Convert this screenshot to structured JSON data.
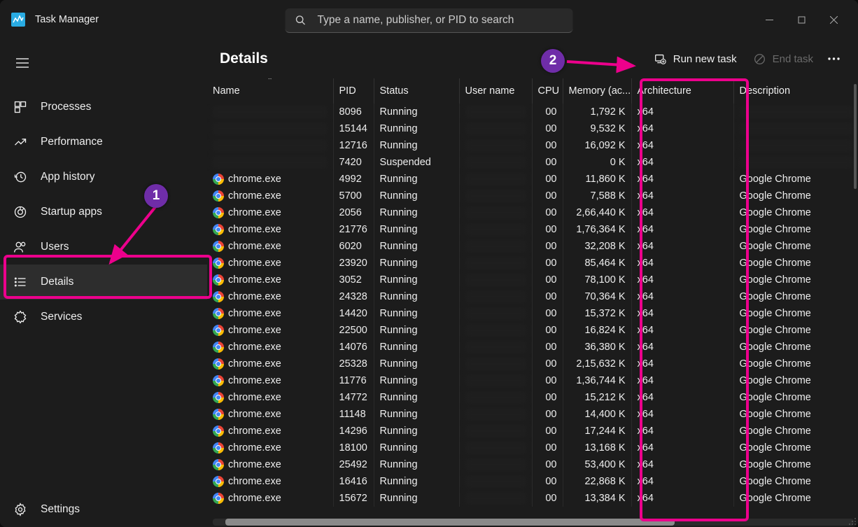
{
  "app": {
    "title": "Task Manager",
    "search_placeholder": "Type a name, publisher, or PID to search"
  },
  "sidebar": {
    "items": [
      {
        "label": "Processes"
      },
      {
        "label": "Performance"
      },
      {
        "label": "App history"
      },
      {
        "label": "Startup apps"
      },
      {
        "label": "Users"
      },
      {
        "label": "Details"
      },
      {
        "label": "Services"
      }
    ],
    "settings_label": "Settings"
  },
  "header": {
    "title": "Details",
    "run_new": "Run new task",
    "end_task": "End task"
  },
  "columns": {
    "name": "Name",
    "pid": "PID",
    "status": "Status",
    "user": "User name",
    "cpu": "CPU",
    "mem": "Memory (ac...",
    "arch": "Architecture",
    "desc": "Description"
  },
  "annotations": {
    "badge1": "1",
    "badge2": "2"
  },
  "rows": [
    {
      "name": "",
      "pid": "8096",
      "status": "Running",
      "cpu": "00",
      "mem": "1,792 K",
      "arch": "x64",
      "desc": "",
      "redact": true
    },
    {
      "name": "",
      "pid": "15144",
      "status": "Running",
      "cpu": "00",
      "mem": "9,532 K",
      "arch": "x64",
      "desc": "",
      "redact": true
    },
    {
      "name": "",
      "pid": "12716",
      "status": "Running",
      "cpu": "00",
      "mem": "16,092 K",
      "arch": "x64",
      "desc": "",
      "redact": true
    },
    {
      "name": "",
      "pid": "7420",
      "status": "Suspended",
      "cpu": "00",
      "mem": "0 K",
      "arch": "x64",
      "desc": "",
      "redact": true
    },
    {
      "name": "chrome.exe",
      "pid": "4992",
      "status": "Running",
      "cpu": "00",
      "mem": "11,860 K",
      "arch": "x64",
      "desc": "Google Chrome"
    },
    {
      "name": "chrome.exe",
      "pid": "5700",
      "status": "Running",
      "cpu": "00",
      "mem": "7,588 K",
      "arch": "x64",
      "desc": "Google Chrome"
    },
    {
      "name": "chrome.exe",
      "pid": "2056",
      "status": "Running",
      "cpu": "00",
      "mem": "2,66,440 K",
      "arch": "x64",
      "desc": "Google Chrome"
    },
    {
      "name": "chrome.exe",
      "pid": "21776",
      "status": "Running",
      "cpu": "00",
      "mem": "1,76,364 K",
      "arch": "x64",
      "desc": "Google Chrome"
    },
    {
      "name": "chrome.exe",
      "pid": "6020",
      "status": "Running",
      "cpu": "00",
      "mem": "32,208 K",
      "arch": "x64",
      "desc": "Google Chrome"
    },
    {
      "name": "chrome.exe",
      "pid": "23920",
      "status": "Running",
      "cpu": "00",
      "mem": "85,464 K",
      "arch": "x64",
      "desc": "Google Chrome"
    },
    {
      "name": "chrome.exe",
      "pid": "3052",
      "status": "Running",
      "cpu": "00",
      "mem": "78,100 K",
      "arch": "x64",
      "desc": "Google Chrome"
    },
    {
      "name": "chrome.exe",
      "pid": "24328",
      "status": "Running",
      "cpu": "00",
      "mem": "70,364 K",
      "arch": "x64",
      "desc": "Google Chrome"
    },
    {
      "name": "chrome.exe",
      "pid": "14420",
      "status": "Running",
      "cpu": "00",
      "mem": "15,372 K",
      "arch": "x64",
      "desc": "Google Chrome"
    },
    {
      "name": "chrome.exe",
      "pid": "22500",
      "status": "Running",
      "cpu": "00",
      "mem": "16,824 K",
      "arch": "x64",
      "desc": "Google Chrome"
    },
    {
      "name": "chrome.exe",
      "pid": "14076",
      "status": "Running",
      "cpu": "00",
      "mem": "36,380 K",
      "arch": "x64",
      "desc": "Google Chrome"
    },
    {
      "name": "chrome.exe",
      "pid": "25328",
      "status": "Running",
      "cpu": "00",
      "mem": "2,15,632 K",
      "arch": "x64",
      "desc": "Google Chrome"
    },
    {
      "name": "chrome.exe",
      "pid": "11776",
      "status": "Running",
      "cpu": "00",
      "mem": "1,36,744 K",
      "arch": "x64",
      "desc": "Google Chrome"
    },
    {
      "name": "chrome.exe",
      "pid": "14772",
      "status": "Running",
      "cpu": "00",
      "mem": "15,212 K",
      "arch": "x64",
      "desc": "Google Chrome"
    },
    {
      "name": "chrome.exe",
      "pid": "11148",
      "status": "Running",
      "cpu": "00",
      "mem": "14,400 K",
      "arch": "x64",
      "desc": "Google Chrome"
    },
    {
      "name": "chrome.exe",
      "pid": "14296",
      "status": "Running",
      "cpu": "00",
      "mem": "17,244 K",
      "arch": "x64",
      "desc": "Google Chrome"
    },
    {
      "name": "chrome.exe",
      "pid": "18100",
      "status": "Running",
      "cpu": "00",
      "mem": "13,168 K",
      "arch": "x64",
      "desc": "Google Chrome"
    },
    {
      "name": "chrome.exe",
      "pid": "25492",
      "status": "Running",
      "cpu": "00",
      "mem": "53,400 K",
      "arch": "x64",
      "desc": "Google Chrome"
    },
    {
      "name": "chrome.exe",
      "pid": "16416",
      "status": "Running",
      "cpu": "00",
      "mem": "22,868 K",
      "arch": "x64",
      "desc": "Google Chrome"
    },
    {
      "name": "chrome.exe",
      "pid": "15672",
      "status": "Running",
      "cpu": "00",
      "mem": "13,384 K",
      "arch": "x64",
      "desc": "Google Chrome"
    }
  ]
}
